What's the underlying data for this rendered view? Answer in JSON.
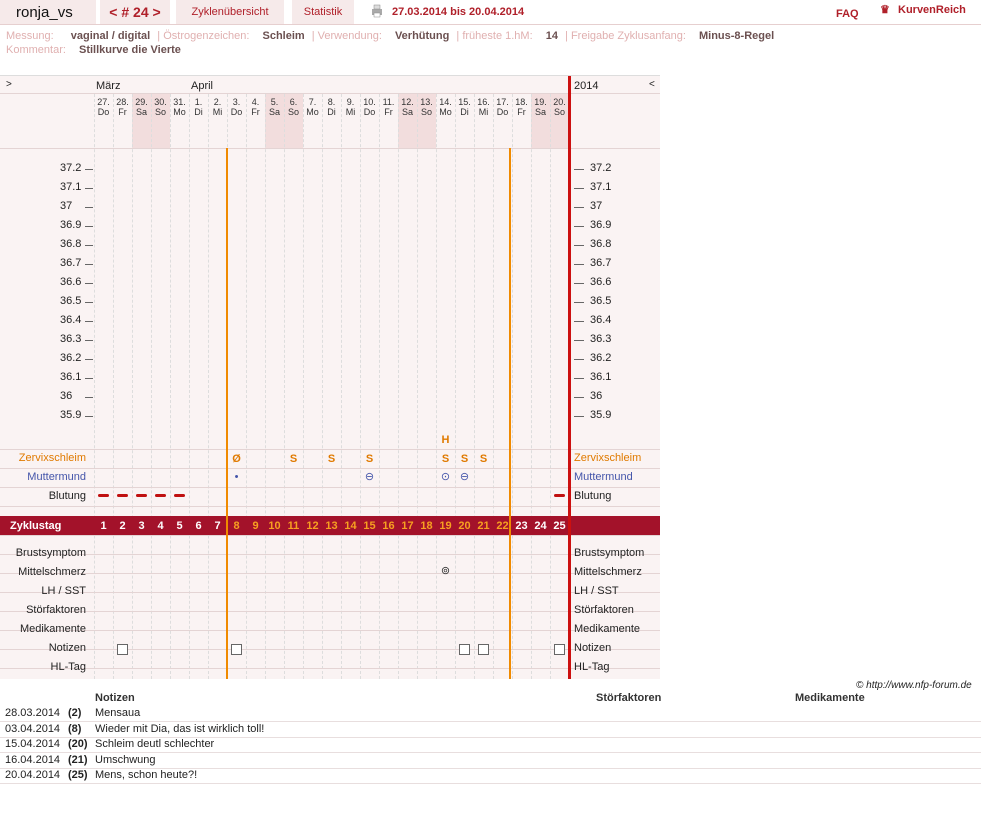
{
  "header": {
    "username": "ronja_vs",
    "cycle_nav": "< # 24 >",
    "tab_overview": "Zyklenübersicht",
    "tab_statistics": "Statistik",
    "date_range": "27.03.2014 bis 20.04.2014",
    "faq": "FAQ",
    "logo": "KurvenReich"
  },
  "meta": {
    "messung_label": "Messung:",
    "messung": "vaginal / digital",
    "oestrogen_label": "Östrogenzeichen:",
    "oestrogen": "Schleim",
    "verwendung_label": "Verwendung:",
    "verwendung": "Verhütung",
    "hm_label": "früheste 1.hM:",
    "hm": "14",
    "freigabe_label": "Freigabe Zyklusanfang:",
    "freigabe": "Minus-8-Regel",
    "kommentar_label": "Kommentar:",
    "kommentar": "Stillkurve die Vierte"
  },
  "chart": {
    "left_arrow": ">",
    "right_arrow": "<",
    "month1": "März",
    "month2": "April",
    "year": "2014",
    "dates": [
      "27.",
      "28.",
      "29.",
      "30.",
      "31.",
      "1.",
      "2.",
      "3.",
      "4.",
      "5.",
      "6.",
      "7.",
      "8.",
      "9.",
      "10.",
      "11.",
      "12.",
      "13.",
      "14.",
      "15.",
      "16.",
      "17.",
      "18.",
      "19.",
      "20."
    ],
    "weekdays": [
      "Do",
      "Fr",
      "Sa",
      "So",
      "Mo",
      "Di",
      "Mi",
      "Do",
      "Fr",
      "Sa",
      "So",
      "Mo",
      "Di",
      "Mi",
      "Do",
      "Fr",
      "Sa",
      "So",
      "Mo",
      "Di",
      "Mi",
      "Do",
      "Fr",
      "Sa",
      "So"
    ],
    "weekend_indices": [
      2,
      3,
      9,
      10,
      16,
      17,
      23,
      24
    ],
    "temperatures": [
      "37.2",
      "37.1",
      "37",
      "36.9",
      "36.8",
      "36.7",
      "36.6",
      "36.5",
      "36.4",
      "36.3",
      "36.2",
      "36.1",
      "36",
      "35.9"
    ],
    "cycle_days": [
      "1",
      "2",
      "3",
      "4",
      "5",
      "6",
      "7",
      "8",
      "9",
      "10",
      "11",
      "12",
      "13",
      "14",
      "15",
      "16",
      "17",
      "18",
      "19",
      "20",
      "21",
      "22",
      "23",
      "24",
      "25"
    ],
    "rows": {
      "zervix": "Zervixschleim",
      "muttermund": "Muttermund",
      "blutung": "Blutung",
      "zyklustag": "Zyklustag",
      "brust": "Brustsymptom",
      "mittelschmerz": "Mittelschmerz",
      "lh": "LH / SST",
      "stoer": "Störfaktoren",
      "medi": "Medikamente",
      "notizen": "Notizen",
      "hltag": "HL-Tag"
    },
    "cervix_marks": [
      {
        "day": 8,
        "mark": "Ø"
      },
      {
        "day": 11,
        "mark": "S"
      },
      {
        "day": 13,
        "mark": "S"
      },
      {
        "day": 15,
        "mark": "S"
      },
      {
        "day": 19,
        "mark": "S"
      },
      {
        "day": 20,
        "mark": "S"
      },
      {
        "day": 21,
        "mark": "S"
      }
    ],
    "h_mark": {
      "day": 19,
      "mark": "H"
    },
    "bleeding_days": [
      1,
      2,
      3,
      4,
      5,
      25
    ],
    "note_days": [
      2,
      8,
      20,
      21,
      25
    ],
    "colors": {
      "brand": "#b0202a",
      "bar": "#a3122a",
      "orange": "#f08a00",
      "cervix": "#e07a00",
      "muttermund": "#4455aa"
    }
  },
  "copyright": "© http://www.nfp-forum.de",
  "notes": {
    "col_notizen": "Notizen",
    "col_stoer": "Störfaktoren",
    "col_medi": "Medikamente",
    "rows": [
      {
        "date": "28.03.2014",
        "day": "(2)",
        "text": "Mensaua"
      },
      {
        "date": "03.04.2014",
        "day": "(8)",
        "text": "Wieder mit Dia, das ist wirklich toll!"
      },
      {
        "date": "15.04.2014",
        "day": "(20)",
        "text": "Schleim deutl schlechter"
      },
      {
        "date": "16.04.2014",
        "day": "(21)",
        "text": "Umschwung"
      },
      {
        "date": "20.04.2014",
        "day": "(25)",
        "text": "Mens, schon heute?!"
      }
    ]
  }
}
